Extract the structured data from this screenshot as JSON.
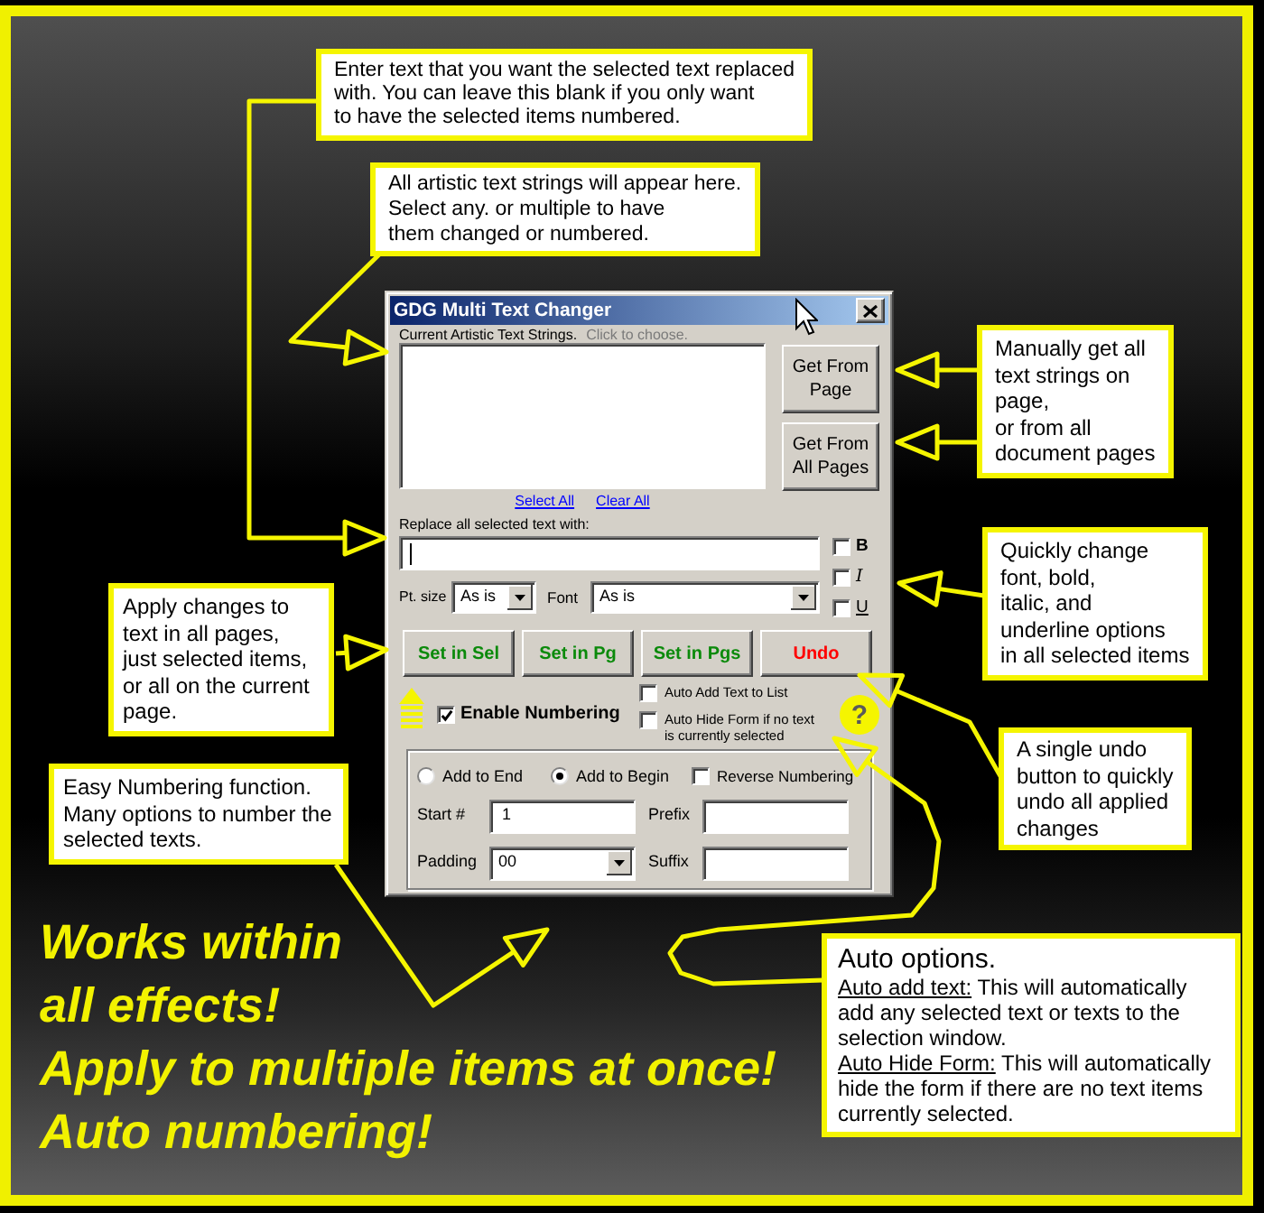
{
  "callouts": [
    {
      "lines": [
        "Enter text that you want the selected text replaced",
        "with. You can leave this blank if you only want",
        "to have the selected items numbered."
      ]
    },
    {
      "lines": [
        "All artistic text strings will appear here.",
        "Select any. or multiple to have",
        "them changed or numbered."
      ]
    },
    {
      "lines": [
        "Manually get all",
        "text strings on",
        "page,",
        "or from all",
        "document pages"
      ]
    },
    {
      "lines": [
        "Quickly change",
        "font, bold,",
        "italic, and",
        "underline options",
        "in all selected items"
      ]
    },
    {
      "lines": [
        "A single undo",
        "button to quickly",
        "undo all applied",
        "changes"
      ]
    },
    {
      "lines": [
        "Apply changes to",
        "text in all pages,",
        "just selected items,",
        "or all on the current",
        "page."
      ]
    },
    {
      "lines": [
        "Easy Numbering function.",
        "Many options to number the",
        "selected texts."
      ]
    }
  ],
  "dialog": {
    "title": "GDG Multi Text Changer",
    "list_label": "Current Artistic Text Strings.",
    "list_hint": "Click to choose.",
    "get_buttons": [
      "Get From Page",
      "Get From All Pages"
    ],
    "links": [
      "Select All",
      "Clear All"
    ],
    "replace_label": "Replace all selected text with:",
    "replace_field": {
      "focused": true
    },
    "style_options": [
      {
        "kind": "bold",
        "label": "B",
        "checked": false
      },
      {
        "kind": "italic",
        "label": "I",
        "checked": false
      },
      {
        "kind": "underline",
        "label": "U",
        "checked": false
      }
    ],
    "size": {
      "label": "Pt. size",
      "value": "As is"
    },
    "font": {
      "label": "Font",
      "value": "As is"
    },
    "action_buttons": [
      {
        "kind": "apply",
        "label": "Set in Sel"
      },
      {
        "kind": "apply",
        "label": "Set in Pg"
      },
      {
        "kind": "apply",
        "label": "Set in Pgs"
      },
      {
        "kind": "undo",
        "label": "Undo"
      }
    ],
    "enable_numbering": {
      "label": "Enable Numbering",
      "checked": true
    },
    "auto_options": [
      {
        "label": "Auto Add Text to List",
        "checked": false
      },
      {
        "label": "Auto Hide Form if no text is currently selected",
        "checked": false
      }
    ],
    "help": "?",
    "numbering": {
      "positions": [
        {
          "label": "Add to End",
          "selected": false
        },
        {
          "label": "Add to Begin",
          "selected": true
        }
      ],
      "reverse": {
        "label": "Reverse Numbering",
        "checked": false
      },
      "start": {
        "label": "Start #",
        "value": "1"
      },
      "prefix": {
        "label": "Prefix"
      },
      "padding": {
        "label": "Padding",
        "value": "00"
      },
      "suffix": {
        "label": "Suffix"
      }
    }
  },
  "auto_note": {
    "title": "Auto options.",
    "entries": [
      {
        "term": "Auto add text:",
        "text": "This will automatically add any selected text or texts to the selection window."
      },
      {
        "term": "Auto Hide Form:",
        "text": "This will automatically hide the form if there are no text items currently selected."
      }
    ]
  },
  "headline": [
    {
      "lines": [
        "Works within",
        "all effects!"
      ]
    },
    {
      "lines": [
        "Apply to multiple items at once!"
      ]
    },
    {
      "lines": [
        "Auto numbering!"
      ]
    }
  ]
}
